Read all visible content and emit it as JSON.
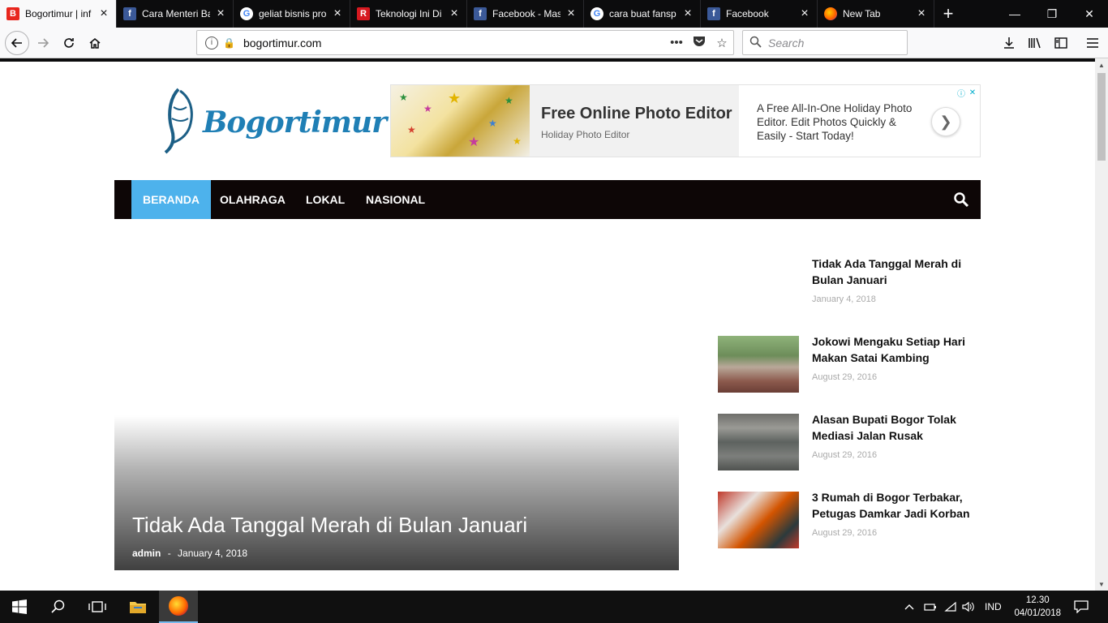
{
  "browser": {
    "tabs": [
      {
        "title": "Bogortimur | inf",
        "favicon": "bogortimur-favicon-icon",
        "fav_color": "#e8261d",
        "fav_text": "B",
        "active": true
      },
      {
        "title": "Cara Menteri Ba",
        "favicon": "facebook-icon",
        "fav_color": "#3b5998",
        "fav_text": "f",
        "active": false
      },
      {
        "title": "geliat bisnis pro",
        "favicon": "google-icon",
        "fav_color": "#ffffff",
        "fav_text": "G",
        "active": false
      },
      {
        "title": "Teknologi Ini Di",
        "favicon": "r-icon",
        "fav_color": "#d71920",
        "fav_text": "R",
        "active": false
      },
      {
        "title": "Facebook - Mas",
        "favicon": "facebook-icon",
        "fav_color": "#3b5998",
        "fav_text": "f",
        "active": false
      },
      {
        "title": "cara buat fansp",
        "favicon": "google-icon",
        "fav_color": "#ffffff",
        "fav_text": "G",
        "active": false
      },
      {
        "title": "Facebook",
        "favicon": "facebook-icon",
        "fav_color": "#3b5998",
        "fav_text": "f",
        "active": false
      },
      {
        "title": "New Tab",
        "favicon": "firefox-icon",
        "fav_color": "#ff9500",
        "fav_text": "",
        "active": false
      }
    ],
    "url": "bogortimur.com",
    "search_placeholder": "Search"
  },
  "site": {
    "logo_text": "Bogortimur",
    "ad": {
      "headline": "Free Online Photo Editor",
      "brand": "Holiday Photo Editor",
      "description": "A Free All-In-One Holiday Photo Editor. Edit Photos Quickly & Easily - Start Today!"
    },
    "menu": [
      {
        "label": "BERANDA",
        "active": true
      },
      {
        "label": "OLAHRAGA",
        "active": false
      },
      {
        "label": "LOKAL",
        "active": false
      },
      {
        "label": "NASIONAL",
        "active": false
      }
    ],
    "accent_color": "#4db2ec",
    "feature": {
      "title": "Tidak Ada Tanggal Merah di Bulan Januari",
      "author": "admin",
      "separator": "-",
      "date": "January 4, 2018"
    },
    "sidebar": [
      {
        "title": "Tidak Ada Tanggal Merah di Bulan Januari",
        "date": "January 4, 2018",
        "has_thumb": false
      },
      {
        "title": "Jokowi Mengaku Setiap Hari Makan Satai Kambing",
        "date": "August 29, 2016",
        "has_thumb": true
      },
      {
        "title": "Alasan Bupati Bogor Tolak Mediasi Jalan Rusak",
        "date": "August 29, 2016",
        "has_thumb": true
      },
      {
        "title": "3 Rumah di Bogor Terbakar, Petugas Damkar Jadi Korban",
        "date": "August 29, 2016",
        "has_thumb": true
      }
    ]
  },
  "taskbar": {
    "language": "IND",
    "time": "12.30",
    "date": "04/01/2018"
  }
}
